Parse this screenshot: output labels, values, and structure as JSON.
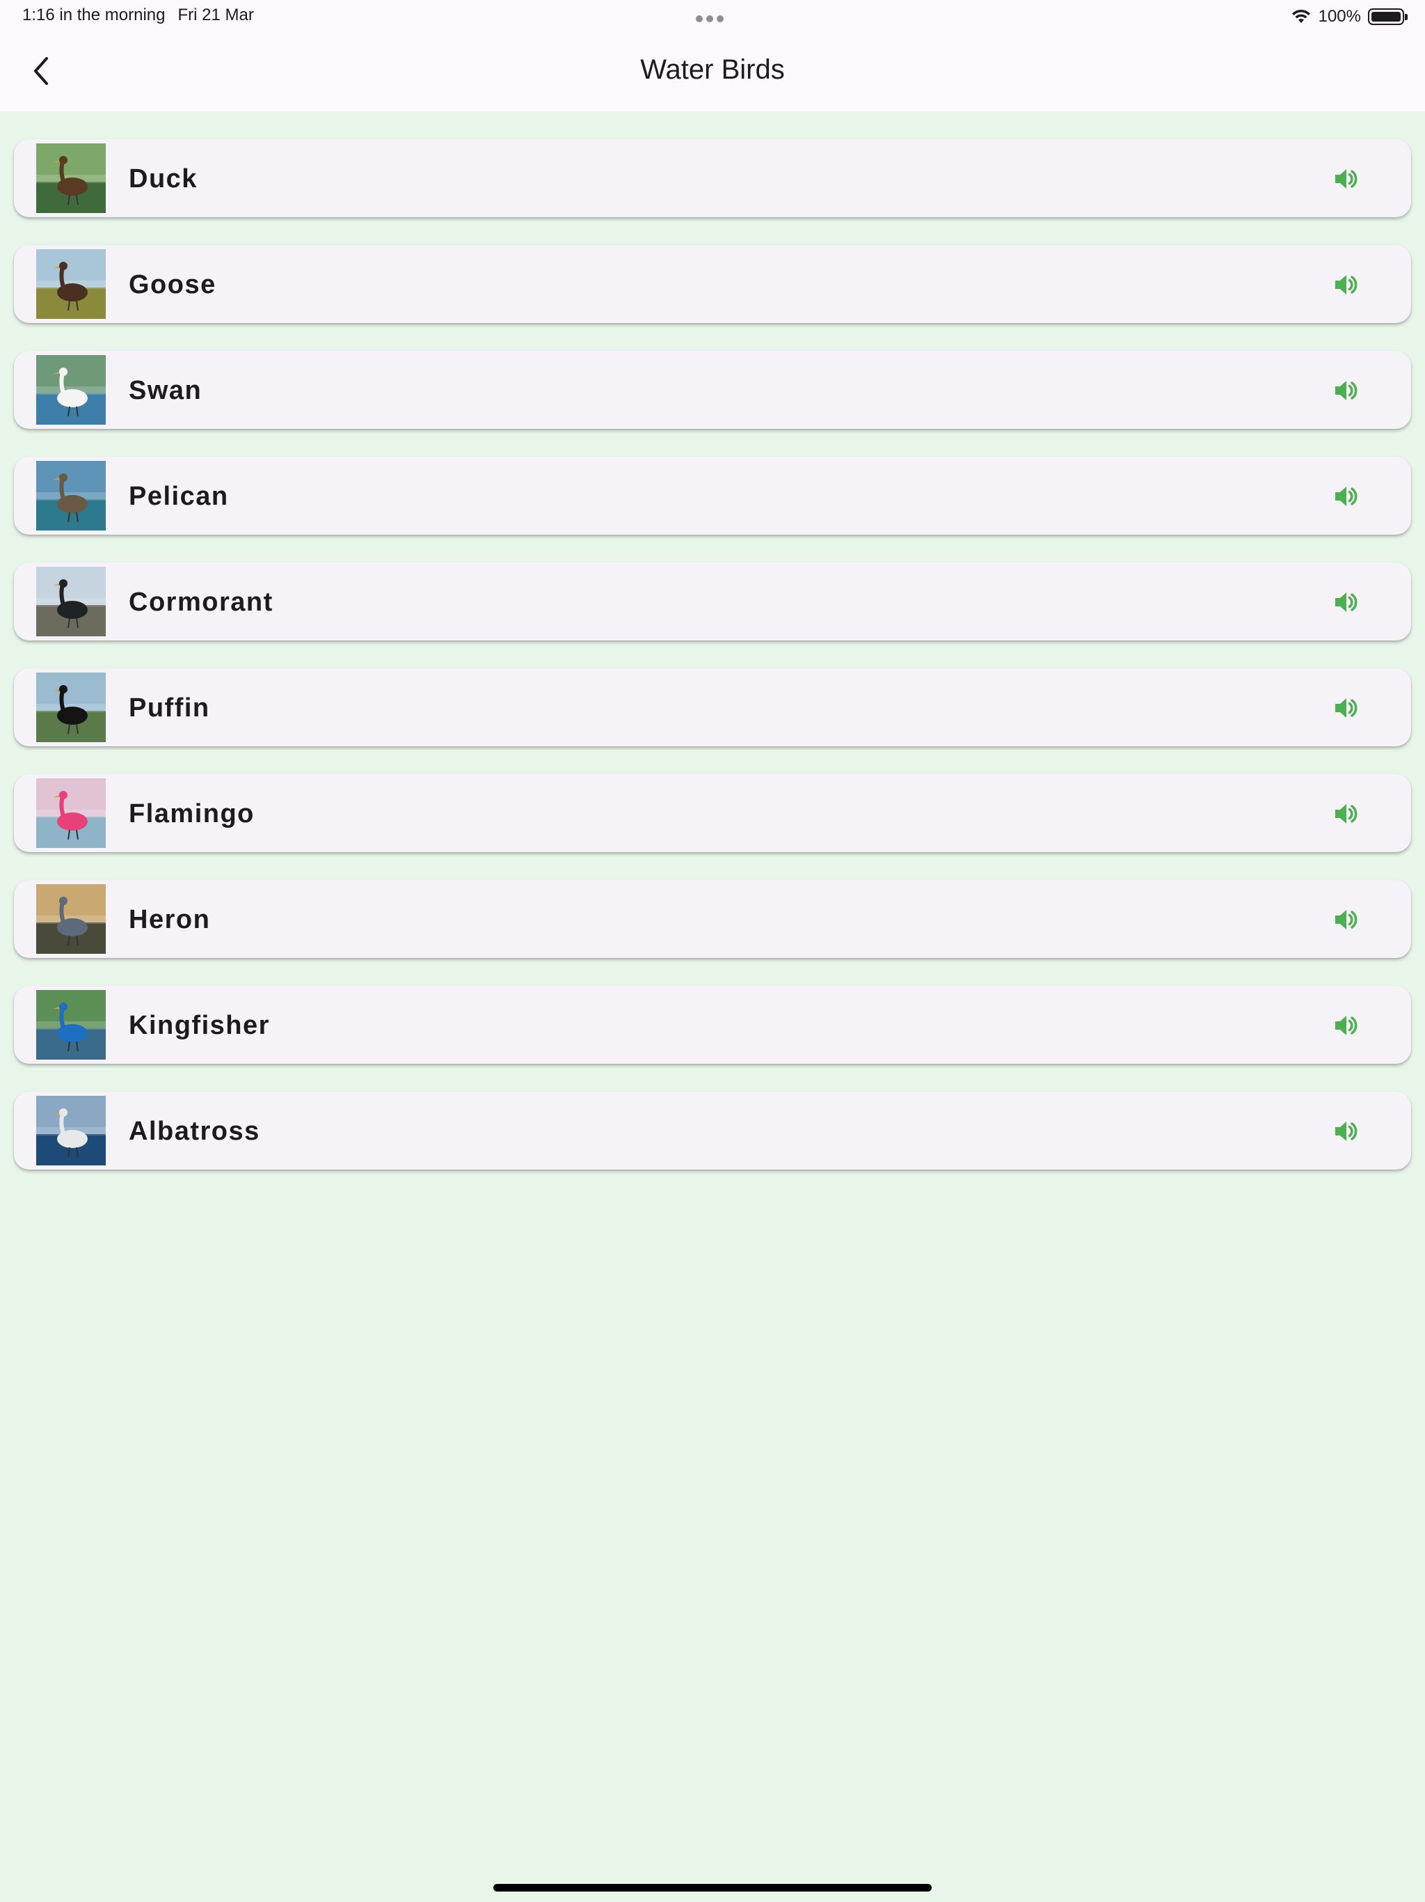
{
  "status_bar": {
    "time": "1:16 in the morning",
    "date": "Fri 21 Mar",
    "battery": "100%"
  },
  "app_bar": {
    "title": "Water Birds",
    "back_icon": "chevron-left-icon"
  },
  "birds": [
    {
      "name": "Duck",
      "sound_icon": "volume-up-icon",
      "thumb": {
        "sky": "#7da86a",
        "ground": "#3f6b3a",
        "bird": "#5a3a22"
      }
    },
    {
      "name": "Goose",
      "sound_icon": "volume-up-icon",
      "thumb": {
        "sky": "#a9c6d8",
        "ground": "#8a8a3a",
        "bird": "#4a3020"
      }
    },
    {
      "name": "Swan",
      "sound_icon": "volume-up-icon",
      "thumb": {
        "sky": "#6e9a7a",
        "ground": "#3d7fa8",
        "bird": "#f4f4f4"
      }
    },
    {
      "name": "Pelican",
      "sound_icon": "volume-up-icon",
      "thumb": {
        "sky": "#5e94b8",
        "ground": "#2d7a8e",
        "bird": "#6a5a44"
      }
    },
    {
      "name": "Cormorant",
      "sound_icon": "volume-up-icon",
      "thumb": {
        "sky": "#c5d4df",
        "ground": "#6d6a5e",
        "bird": "#1f2326"
      }
    },
    {
      "name": "Puffin",
      "sound_icon": "volume-up-icon",
      "thumb": {
        "sky": "#9bbcd0",
        "ground": "#5b7a4a",
        "bird": "#141414"
      }
    },
    {
      "name": "Flamingo",
      "sound_icon": "volume-up-icon",
      "thumb": {
        "sky": "#e2c3d4",
        "ground": "#8fb3c7",
        "bird": "#e8407a"
      }
    },
    {
      "name": "Heron",
      "sound_icon": "volume-up-icon",
      "thumb": {
        "sky": "#c9a872",
        "ground": "#4a4a3a",
        "bird": "#5d6a7a"
      }
    },
    {
      "name": "Kingfisher",
      "sound_icon": "volume-up-icon",
      "thumb": {
        "sky": "#5c8f55",
        "ground": "#3a6b8a",
        "bird": "#1e6fc2"
      }
    },
    {
      "name": "Albatross",
      "sound_icon": "volume-up-icon",
      "thumb": {
        "sky": "#8aa8c4",
        "ground": "#1e4a78",
        "bird": "#e8e8e8"
      }
    }
  ],
  "colors": {
    "background": "#e8f5e9",
    "app_bar": "#fdf7fe",
    "card": "#f5f2f8",
    "accent": "#4caf50"
  }
}
